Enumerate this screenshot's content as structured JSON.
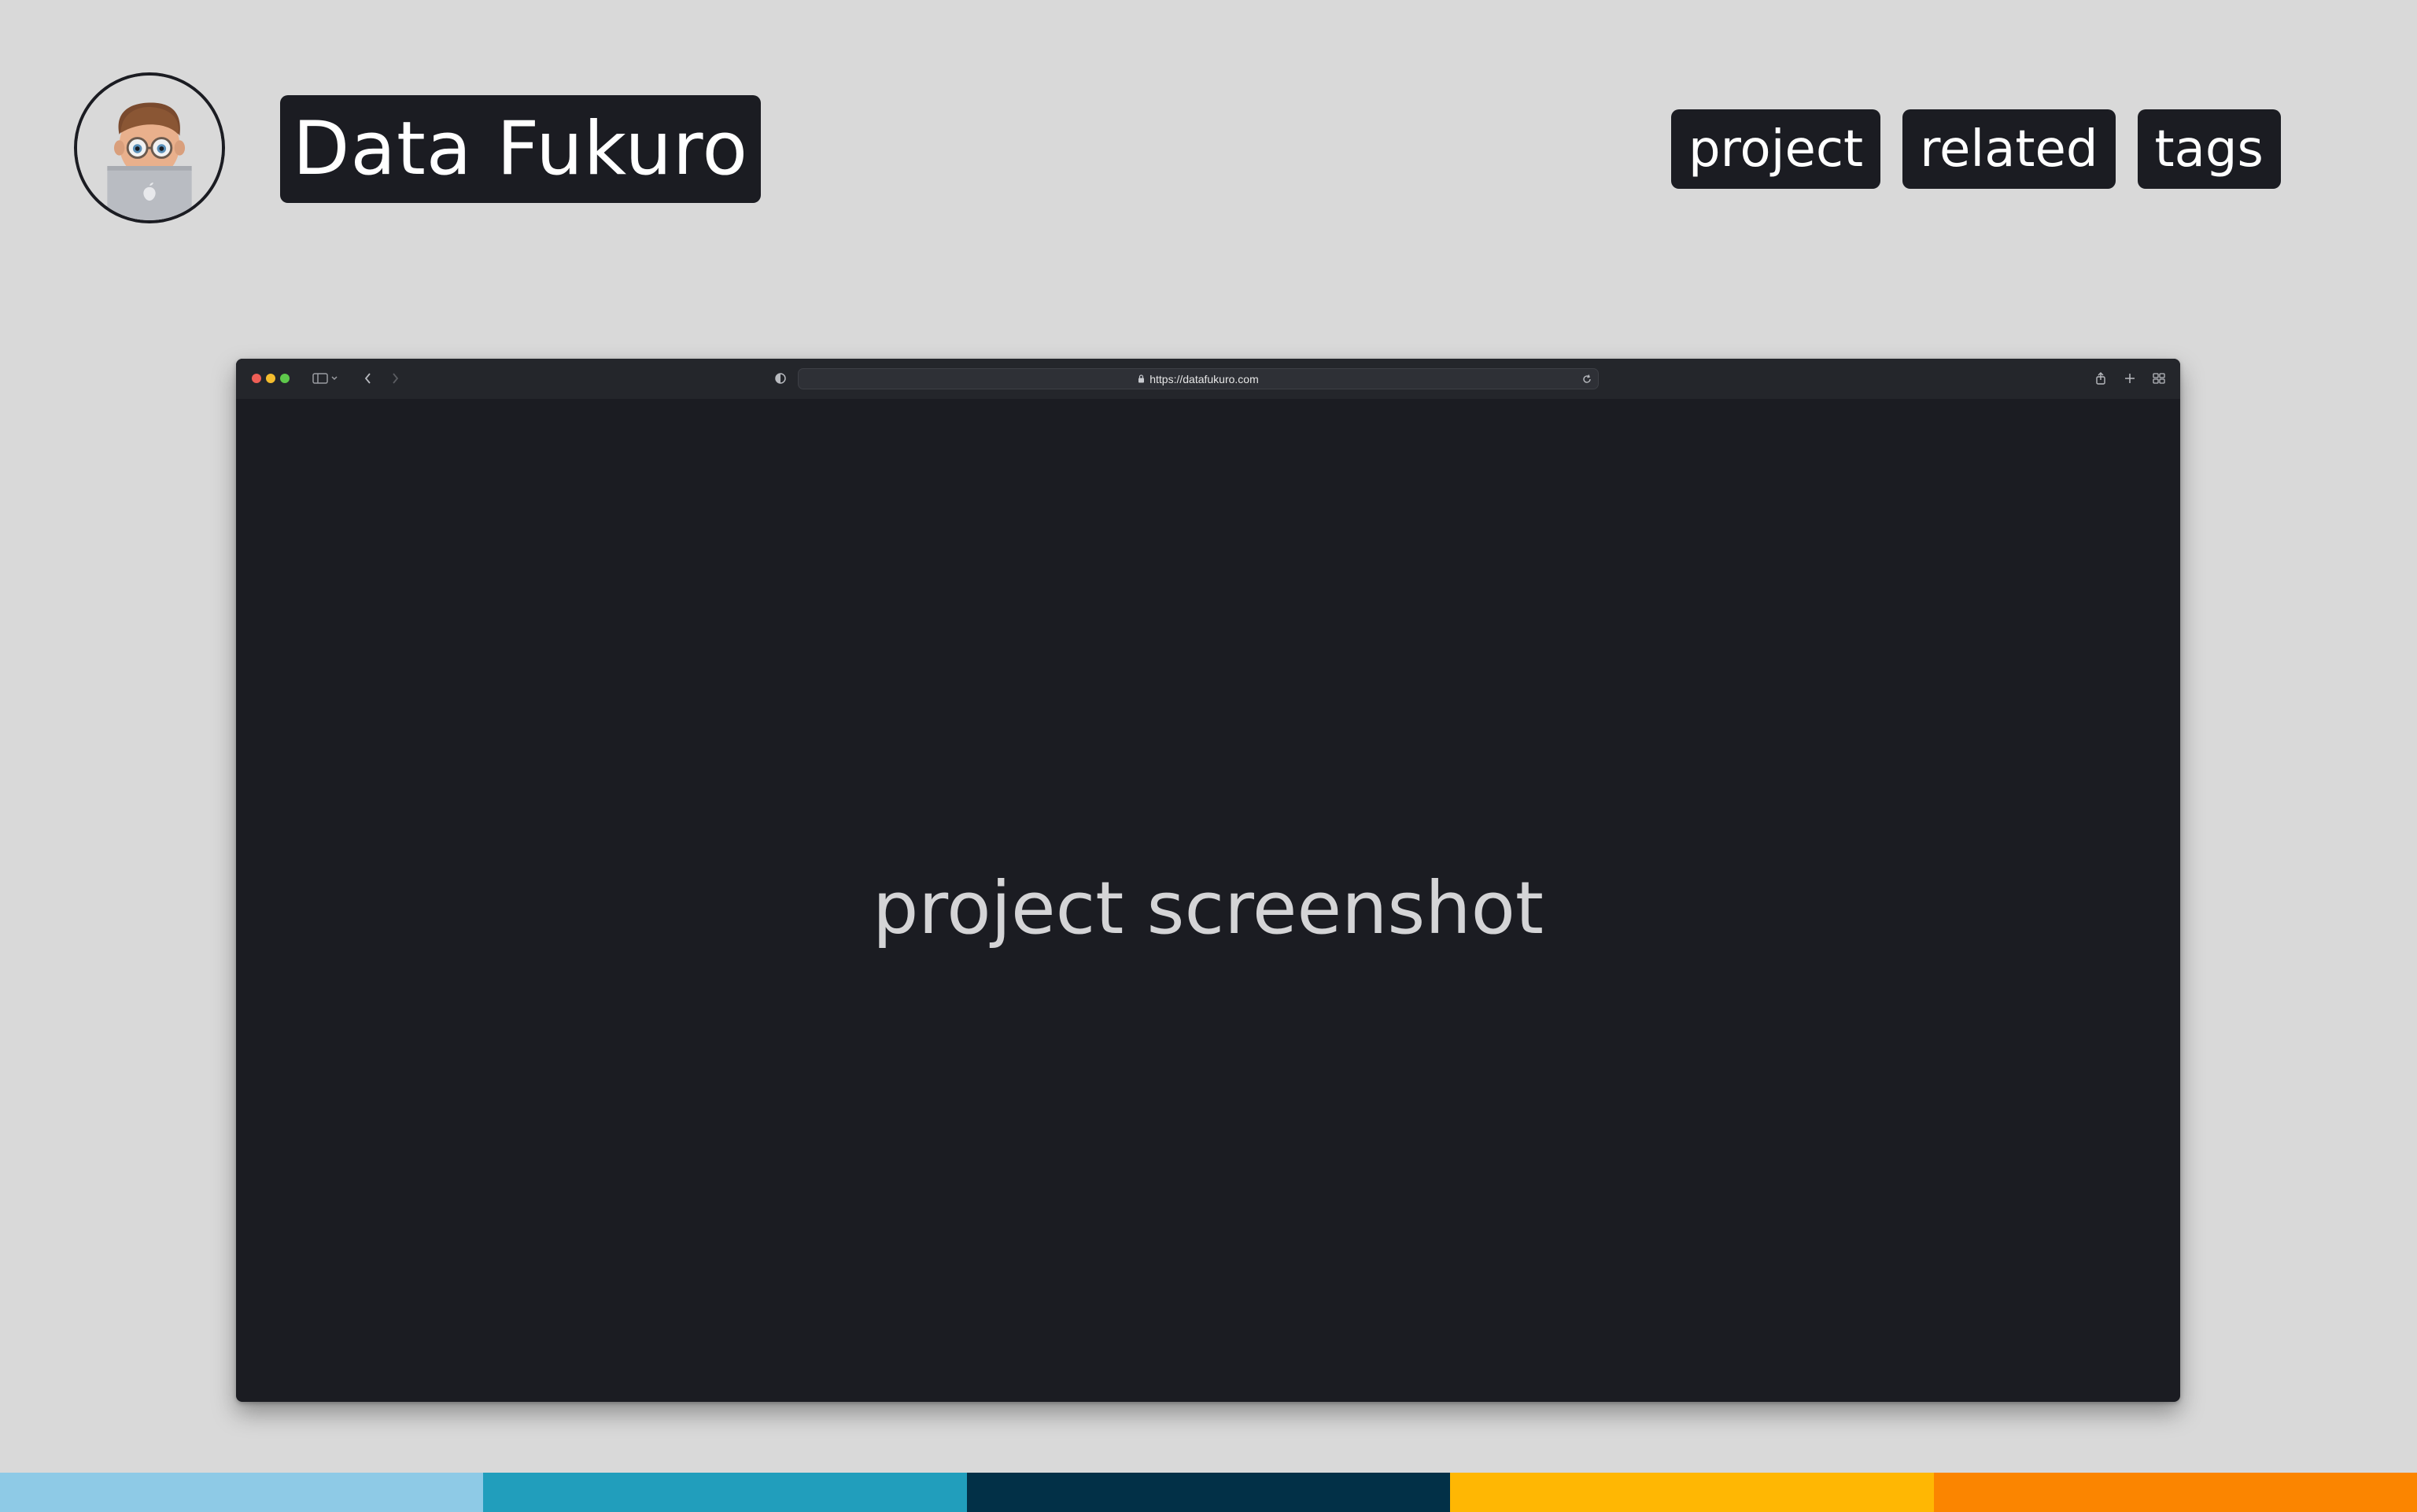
{
  "header": {
    "avatar_label": "avatar",
    "title": "Data Fukuro",
    "tags": [
      "project",
      "related",
      "tags"
    ]
  },
  "browser": {
    "url": "https://datafukuro.com",
    "content_text": "project screenshot",
    "traffic_light_colors": [
      "#ee5e56",
      "#f4bd2e",
      "#5ec84b"
    ]
  },
  "colors": {
    "background": "#d9d9d9",
    "badge": "#1b1c22",
    "strip": [
      "#8ecae6",
      "#219ebc",
      "#023047",
      "#ffb703",
      "#fb8500"
    ]
  }
}
